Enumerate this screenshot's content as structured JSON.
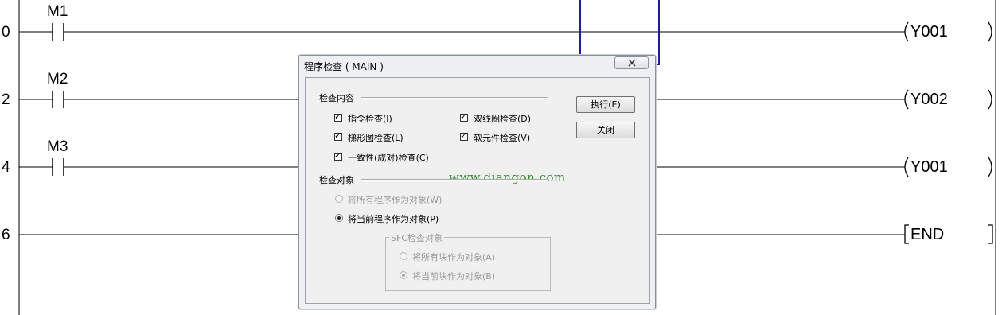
{
  "ladder": {
    "steps": [
      "0",
      "2",
      "4",
      "6"
    ],
    "contacts": [
      "M1",
      "M2",
      "M3"
    ],
    "coils": [
      "Y001",
      "Y002",
      "Y001",
      "END"
    ]
  },
  "dialog": {
    "title": "程序检查 ( MAIN )",
    "close_icon": "close-x-icon",
    "check_content": {
      "label": "检查内容",
      "items": [
        {
          "label": "指令检查(I)",
          "checked": true
        },
        {
          "label": "双线圈检查(D)",
          "checked": true
        },
        {
          "label": "梯形图检查(L)",
          "checked": true
        },
        {
          "label": "软元件检查(V)",
          "checked": true
        },
        {
          "label": "一致性(成对)检查(C)",
          "checked": true
        }
      ]
    },
    "check_target": {
      "label": "检查对象",
      "options": [
        {
          "label": "将所有程序作为对象(W)",
          "selected": false,
          "enabled": false
        },
        {
          "label": "将当前程序作为对象(P)",
          "selected": true,
          "enabled": true
        }
      ]
    },
    "sfc": {
      "label": "SFC检查对象",
      "options": [
        {
          "label": "将所有块作为对象(A)",
          "selected": false,
          "enabled": false
        },
        {
          "label": "将当前块作为对象(B)",
          "selected": true,
          "enabled": false
        }
      ]
    },
    "buttons": {
      "execute": "执行(E)",
      "close": "关闭"
    },
    "watermark": "www.diangon.com"
  },
  "colors": {
    "highlight": "#1f1f8f",
    "watermark": "#2f8f2f"
  }
}
